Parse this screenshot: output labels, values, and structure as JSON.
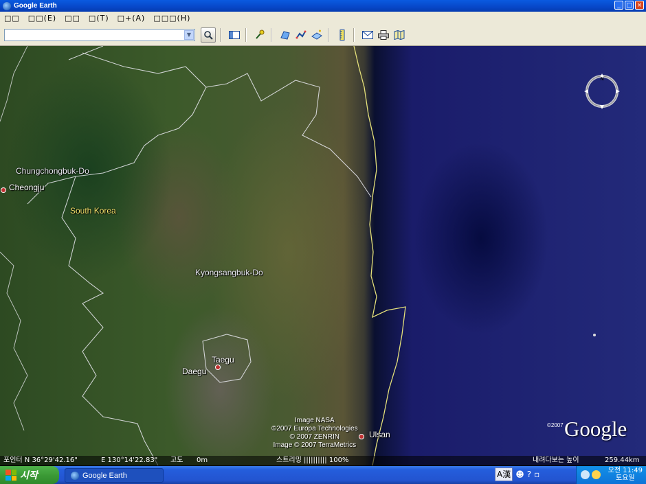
{
  "window": {
    "title": "Google Earth",
    "buttons": {
      "minimize": "_",
      "maximize": "□",
      "close": "×"
    }
  },
  "menu": {
    "items": [
      "□□",
      "□□(E)",
      "□□",
      "□(T)",
      "□+(A)",
      "□□□(H)"
    ]
  },
  "toolbar": {
    "search_value": "",
    "search_placeholder": ""
  },
  "map": {
    "labels": {
      "chungchongbuk": "Chungchongbuk-Do",
      "cheongju": "Cheongju",
      "south_korea": "South Korea",
      "kyongsangbuk": "Kyongsangbuk-Do",
      "taegu": "Taegu",
      "daegu": "Daegu",
      "ulsan": "Ulsan"
    },
    "credits": [
      "Image NASA",
      "©2007 Europa Technologies",
      "© 2007 ZENRIN",
      "Image © 2007 TerraMetrics"
    ],
    "copyright": "©2007",
    "logo": "Google",
    "compass_north": "N"
  },
  "status": {
    "pointer": "포인터 N 36°29'42.16\"",
    "longitude": "E 130°14'22.83\"",
    "elevation_label": "고도",
    "elevation_value": "0m",
    "streaming": "스트리밍 |||||||||| 100%",
    "eye_alt_label": "내려다보는 높이",
    "eye_alt_value": "259.44km"
  },
  "taskbar": {
    "start_label": "시작",
    "task_label": "Google Earth",
    "ime_mode": "A",
    "ime_hanja": "漢",
    "clock_time": "오전 11:49",
    "clock_day": "토요일"
  },
  "colors": {
    "title_bar": "#0747c8",
    "start_green": "#3c9a36",
    "ocean": "#1a1c6a"
  }
}
